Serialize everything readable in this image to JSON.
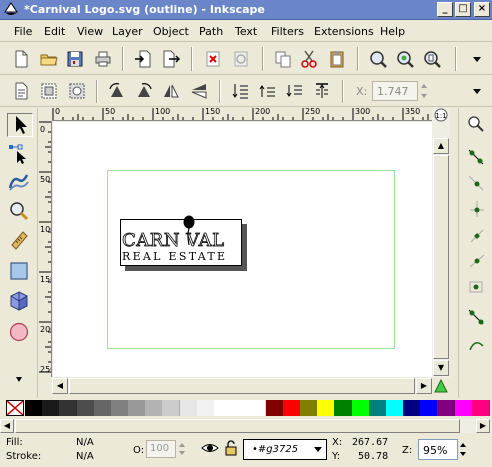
{
  "window": {
    "title": "*Carnival Logo.svg (outline) - Inkscape",
    "minimize_label": "_",
    "maximize_label": "□",
    "close_label": "×"
  },
  "menubar": {
    "items": [
      {
        "name": "menu-file",
        "label": "File"
      },
      {
        "name": "menu-edit",
        "label": "Edit"
      },
      {
        "name": "menu-view",
        "label": "View"
      },
      {
        "name": "menu-layer",
        "label": "Layer"
      },
      {
        "name": "menu-object",
        "label": "Object"
      },
      {
        "name": "menu-path",
        "label": "Path"
      },
      {
        "name": "menu-text",
        "label": "Text"
      },
      {
        "name": "menu-filters",
        "label": "Filters"
      },
      {
        "name": "menu-extensions",
        "label": "Extensions"
      },
      {
        "name": "menu-help",
        "label": "Help"
      }
    ]
  },
  "controls": {
    "x_label": "X:",
    "x_value": "1.747"
  },
  "ruler": {
    "h_ticks": [
      "0",
      "50",
      "100",
      "150",
      "200",
      "250",
      "300",
      "350"
    ],
    "v_ticks": [
      "0",
      "50",
      "100",
      "150",
      "200",
      "250"
    ]
  },
  "logo": {
    "line1": "CARN VAL",
    "line2": "REAL ESTATE"
  },
  "palette": {
    "colors": [
      "#000000",
      "#1a1a1a",
      "#333333",
      "#4d4d4d",
      "#666666",
      "#808080",
      "#999999",
      "#b3b3b3",
      "#cccccc",
      "#e6e6e6",
      "#f2f2f2",
      "#ffffff",
      "#ffffff",
      "#ffffff",
      "#800000",
      "#ff0000",
      "#808000",
      "#ffff00",
      "#008000",
      "#00ff00",
      "#008080",
      "#00ffff",
      "#000080",
      "#0000ff",
      "#800080",
      "#ff00ff",
      "#ff0080"
    ]
  },
  "status": {
    "fill_label": "Fill:",
    "fill_value": "N/A",
    "stroke_label": "Stroke:",
    "stroke_value": "N/A",
    "opacity_label": "O:",
    "opacity_value": "100",
    "layer_value": "•#g3725",
    "x_label": "X:",
    "x_value": "267.67",
    "y_label": "Y:",
    "y_value": "50.78",
    "zoom_label": "Z:",
    "zoom_value": "95%"
  }
}
